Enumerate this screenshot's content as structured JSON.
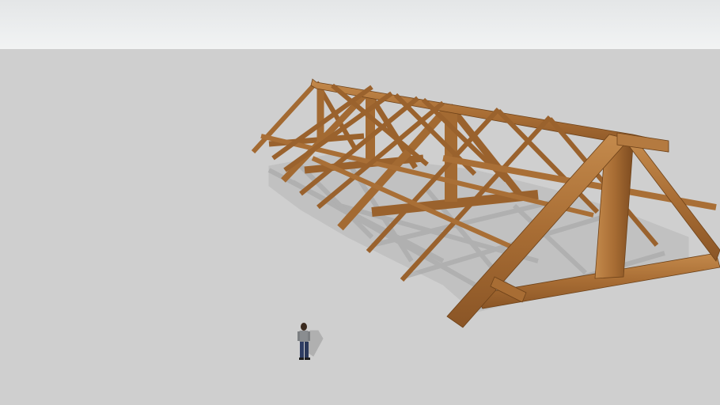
{
  "viewport": {
    "view": "perspective-3d",
    "style": "shaded-with-textures",
    "shadows": true
  },
  "colors": {
    "sky": "#eceeef",
    "ground": "#cfcfcf",
    "shadow": "#a9a9a9",
    "timber_light": "#b87d42",
    "timber_mid": "#a36a32",
    "timber_dark": "#7a4a1f"
  },
  "model": {
    "type": "timber-roof-truss-frame",
    "truss_count": 4,
    "scale_figure": "person"
  }
}
